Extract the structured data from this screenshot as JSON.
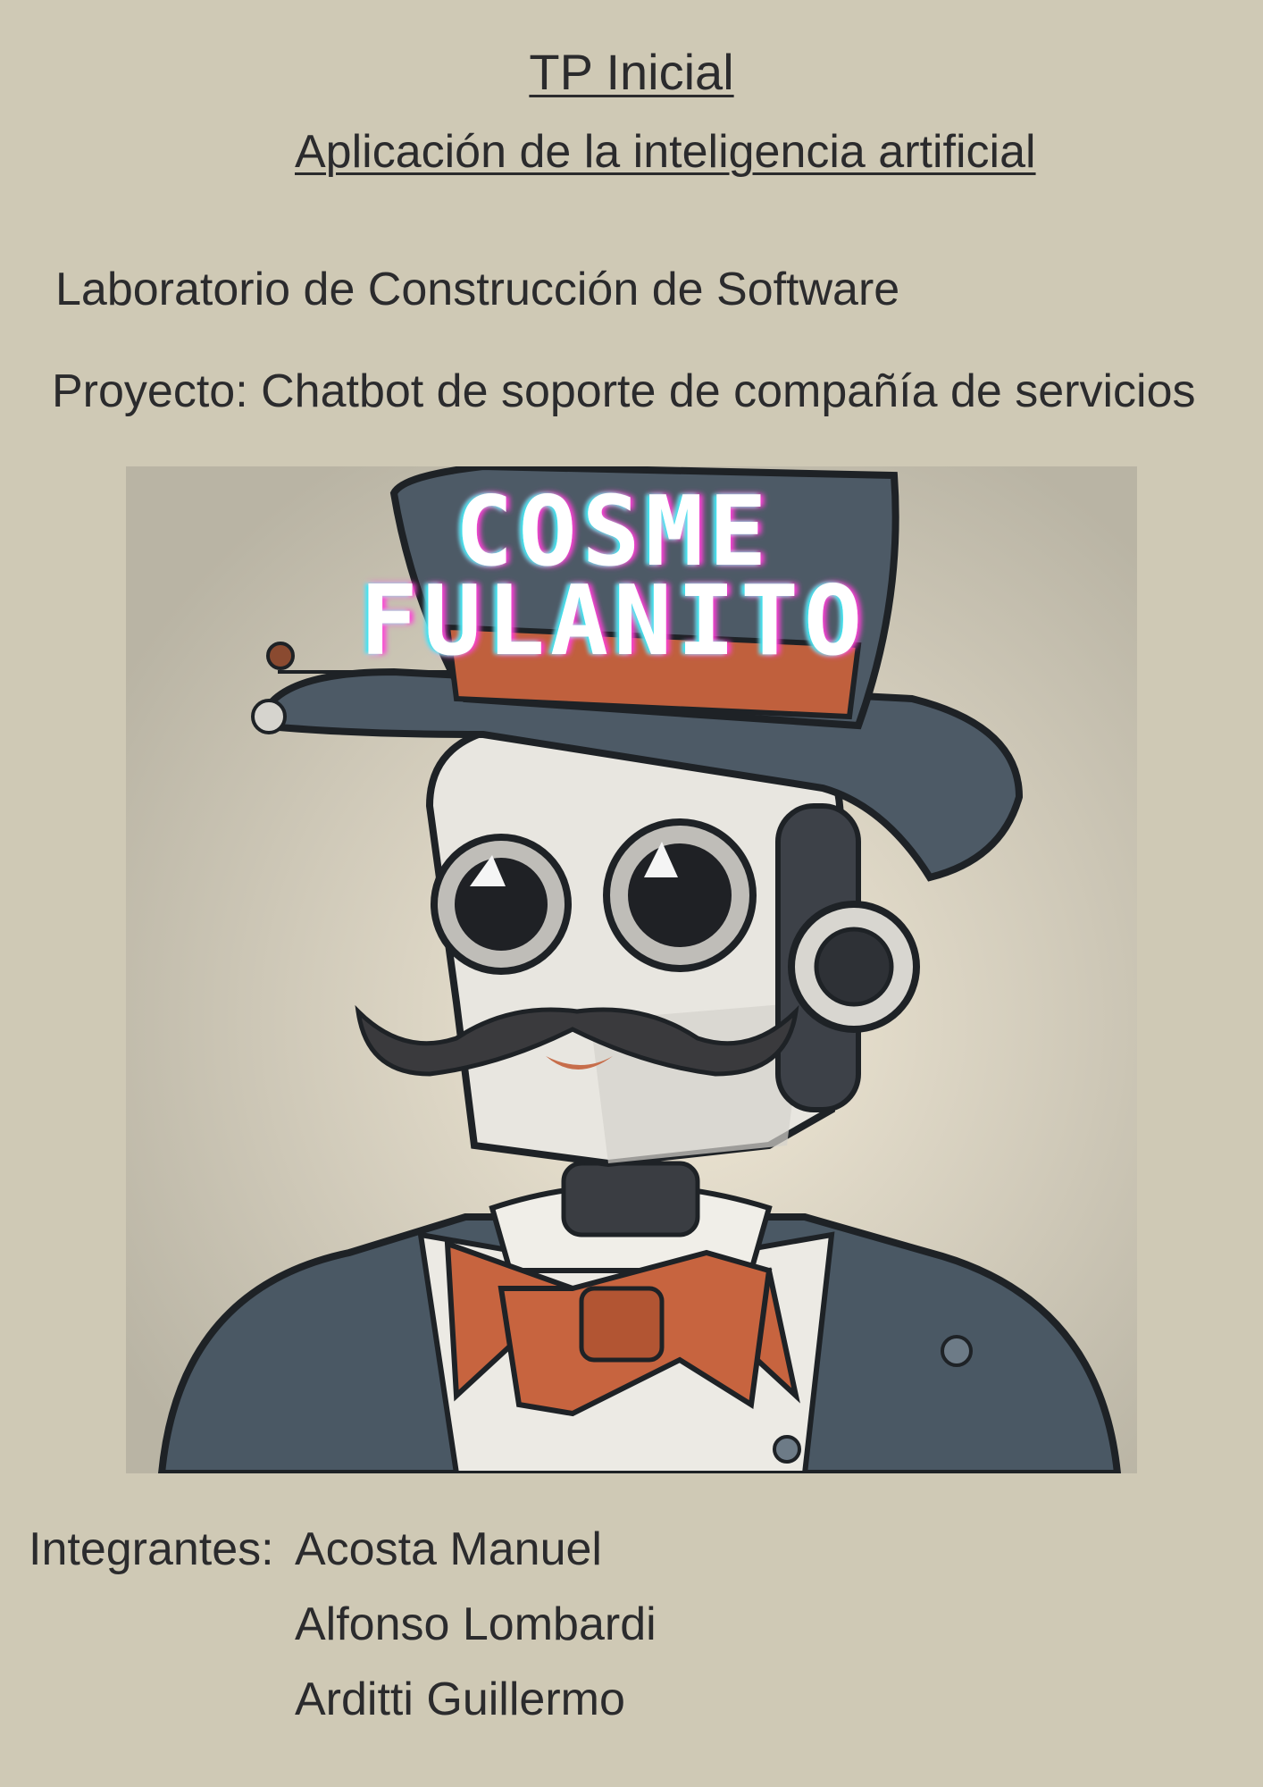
{
  "header": {
    "title": "TP Inicial",
    "subtitle": "Aplicación de la inteligencia artificial"
  },
  "info": {
    "course": "Laboratorio de Construcción de Software",
    "project": "Proyecto: Chatbot de soporte de compañía de servicios"
  },
  "cover_image": {
    "title_line1": "COSME",
    "title_line2": "FULANITO",
    "title_color": "#ffffff",
    "glow_color": "#ff3fd8",
    "accent_color": "#2fe6f0"
  },
  "members": {
    "label": "Integrantes:",
    "names": [
      "Acosta Manuel",
      "Alfonso Lombardi",
      "Arditti Guillermo"
    ]
  }
}
